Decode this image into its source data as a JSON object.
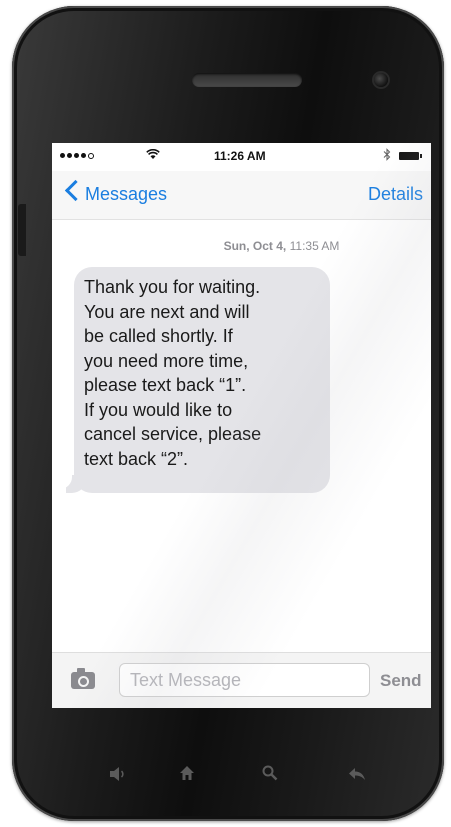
{
  "status_bar": {
    "time": "11:26 AM",
    "signal_icon": "signal-dots-icon",
    "wifi_icon": "wifi-icon",
    "bluetooth_icon": "bluetooth-icon",
    "battery_icon": "battery-icon"
  },
  "nav": {
    "back_label": "Messages",
    "details_label": "Details",
    "accent_color": "#1a7ee0"
  },
  "conversation": {
    "timestamp_date": "Sun, Oct 4,",
    "timestamp_time": "11:35 AM",
    "messages": [
      {
        "direction": "incoming",
        "text": "Thank you for waiting.\nYou are next and will\nbe called shortly. If\nyou need more time,\nplease text back “1”.\nIf you would like to\ncancel service, please\ntext back “2”."
      }
    ]
  },
  "composer": {
    "camera_icon": "camera-icon",
    "placeholder": "Text Message",
    "value": "",
    "send_label": "Send"
  },
  "hardware_buttons": {
    "back_glyph": "◀",
    "home_glyph": "⌂",
    "search_glyph": "⚲",
    "return_glyph": "↩",
    "icons": [
      "speaker-icon",
      "home-icon",
      "search-icon",
      "reply-icon"
    ]
  }
}
